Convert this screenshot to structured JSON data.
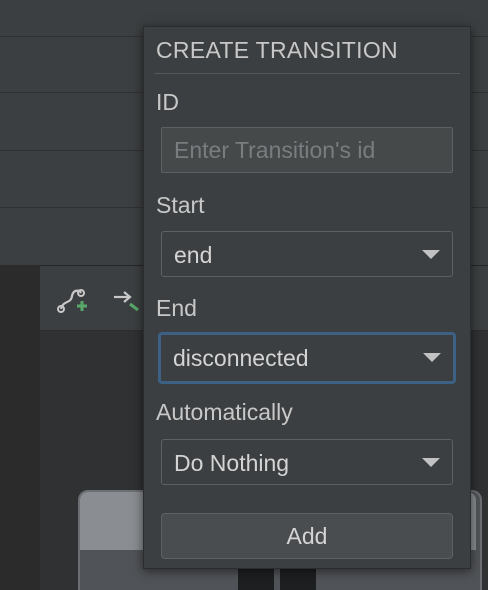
{
  "dialog": {
    "title": "CREATE TRANSITION",
    "id_label": "ID",
    "id_placeholder": "Enter Transition's id",
    "id_value": "",
    "start_label": "Start",
    "start_value": "end",
    "end_label": "End",
    "end_value": "disconnected",
    "auto_label": "Automatically",
    "auto_value": "Do Nothing",
    "add_label": "Add"
  },
  "toolbar": {
    "icons": [
      "create-transition-icon",
      "create-click-handler-icon"
    ]
  },
  "colors": {
    "panel_bg": "#3c3f41",
    "focus_border": "#3d6185",
    "add_icon_accent": "#59a869"
  }
}
